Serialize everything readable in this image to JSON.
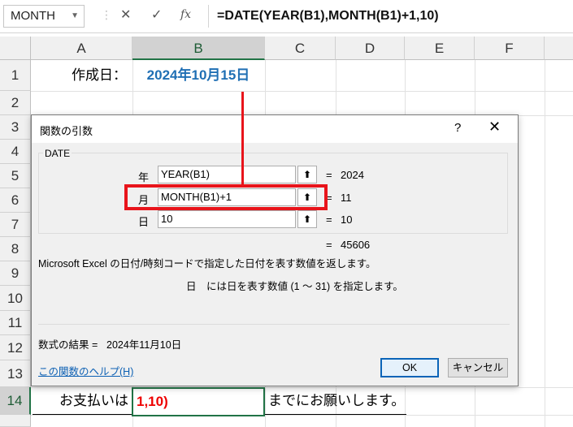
{
  "formula_bar": {
    "name_box": "MONTH",
    "cancel_glyph": "✕",
    "enter_glyph": "✓",
    "fx_glyph": "fx",
    "formula": "=DATE(YEAR(B1),MONTH(B1)+1,10)"
  },
  "columns": [
    "A",
    "B",
    "C",
    "D",
    "E",
    "F"
  ],
  "rows": [
    "1",
    "2",
    "3",
    "4",
    "5",
    "6",
    "7",
    "8",
    "9",
    "10",
    "11",
    "12",
    "13",
    "14"
  ],
  "cells": {
    "A1": "作成日：",
    "B1": "2024年10月15日",
    "A14": "お支払いは",
    "B14": "1,10)",
    "C14": "までにお願いします。"
  },
  "dialog": {
    "title": "関数の引数",
    "help_glyph": "?",
    "close_glyph": "✕",
    "function_name": "DATE",
    "args": [
      {
        "label": "年",
        "value": "YEAR(B1)",
        "result": "2024"
      },
      {
        "label": "月",
        "value": "MONTH(B1)+1",
        "result": "11"
      },
      {
        "label": "日",
        "value": "10",
        "result": "10"
      }
    ],
    "collapse_glyph": "⬆",
    "eq": "=",
    "total_result": "45606",
    "description": "Microsoft Excel の日付/時刻コードで指定した日付を表す数値を返します。",
    "arg_description": "日　には日を表す数値 (1 ～ 31) を指定します。",
    "formula_result_label": "数式の結果 =",
    "formula_result_value": "2024年11月10日",
    "help_link": "この関数のヘルプ(H)",
    "ok_label": "OK",
    "cancel_label": "キャンセル"
  },
  "colors": {
    "accent_green": "#217346",
    "annotation_red": "#e8141b",
    "date_blue": "#1f6fb4",
    "link_blue": "#0b5fb3"
  }
}
